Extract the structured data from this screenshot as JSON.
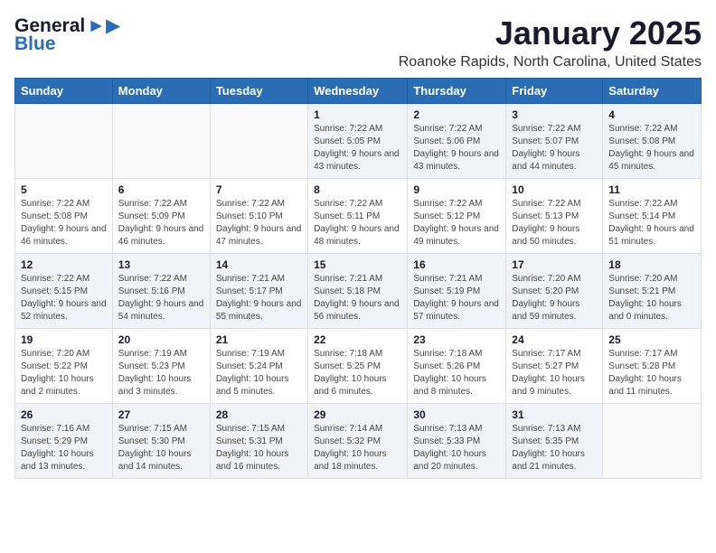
{
  "header": {
    "logo_line1": "General",
    "logo_line2": "Blue",
    "month": "January 2025",
    "location": "Roanoke Rapids, North Carolina, United States"
  },
  "weekdays": [
    "Sunday",
    "Monday",
    "Tuesday",
    "Wednesday",
    "Thursday",
    "Friday",
    "Saturday"
  ],
  "weeks": [
    [
      {
        "day": "",
        "info": ""
      },
      {
        "day": "",
        "info": ""
      },
      {
        "day": "",
        "info": ""
      },
      {
        "day": "1",
        "info": "Sunrise: 7:22 AM\nSunset: 5:05 PM\nDaylight: 9 hours and 43 minutes."
      },
      {
        "day": "2",
        "info": "Sunrise: 7:22 AM\nSunset: 5:06 PM\nDaylight: 9 hours and 43 minutes."
      },
      {
        "day": "3",
        "info": "Sunrise: 7:22 AM\nSunset: 5:07 PM\nDaylight: 9 hours and 44 minutes."
      },
      {
        "day": "4",
        "info": "Sunrise: 7:22 AM\nSunset: 5:08 PM\nDaylight: 9 hours and 45 minutes."
      }
    ],
    [
      {
        "day": "5",
        "info": "Sunrise: 7:22 AM\nSunset: 5:08 PM\nDaylight: 9 hours and 46 minutes."
      },
      {
        "day": "6",
        "info": "Sunrise: 7:22 AM\nSunset: 5:09 PM\nDaylight: 9 hours and 46 minutes."
      },
      {
        "day": "7",
        "info": "Sunrise: 7:22 AM\nSunset: 5:10 PM\nDaylight: 9 hours and 47 minutes."
      },
      {
        "day": "8",
        "info": "Sunrise: 7:22 AM\nSunset: 5:11 PM\nDaylight: 9 hours and 48 minutes."
      },
      {
        "day": "9",
        "info": "Sunrise: 7:22 AM\nSunset: 5:12 PM\nDaylight: 9 hours and 49 minutes."
      },
      {
        "day": "10",
        "info": "Sunrise: 7:22 AM\nSunset: 5:13 PM\nDaylight: 9 hours and 50 minutes."
      },
      {
        "day": "11",
        "info": "Sunrise: 7:22 AM\nSunset: 5:14 PM\nDaylight: 9 hours and 51 minutes."
      }
    ],
    [
      {
        "day": "12",
        "info": "Sunrise: 7:22 AM\nSunset: 5:15 PM\nDaylight: 9 hours and 52 minutes."
      },
      {
        "day": "13",
        "info": "Sunrise: 7:22 AM\nSunset: 5:16 PM\nDaylight: 9 hours and 54 minutes."
      },
      {
        "day": "14",
        "info": "Sunrise: 7:21 AM\nSunset: 5:17 PM\nDaylight: 9 hours and 55 minutes."
      },
      {
        "day": "15",
        "info": "Sunrise: 7:21 AM\nSunset: 5:18 PM\nDaylight: 9 hours and 56 minutes."
      },
      {
        "day": "16",
        "info": "Sunrise: 7:21 AM\nSunset: 5:19 PM\nDaylight: 9 hours and 57 minutes."
      },
      {
        "day": "17",
        "info": "Sunrise: 7:20 AM\nSunset: 5:20 PM\nDaylight: 9 hours and 59 minutes."
      },
      {
        "day": "18",
        "info": "Sunrise: 7:20 AM\nSunset: 5:21 PM\nDaylight: 10 hours and 0 minutes."
      }
    ],
    [
      {
        "day": "19",
        "info": "Sunrise: 7:20 AM\nSunset: 5:22 PM\nDaylight: 10 hours and 2 minutes."
      },
      {
        "day": "20",
        "info": "Sunrise: 7:19 AM\nSunset: 5:23 PM\nDaylight: 10 hours and 3 minutes."
      },
      {
        "day": "21",
        "info": "Sunrise: 7:19 AM\nSunset: 5:24 PM\nDaylight: 10 hours and 5 minutes."
      },
      {
        "day": "22",
        "info": "Sunrise: 7:18 AM\nSunset: 5:25 PM\nDaylight: 10 hours and 6 minutes."
      },
      {
        "day": "23",
        "info": "Sunrise: 7:18 AM\nSunset: 5:26 PM\nDaylight: 10 hours and 8 minutes."
      },
      {
        "day": "24",
        "info": "Sunrise: 7:17 AM\nSunset: 5:27 PM\nDaylight: 10 hours and 9 minutes."
      },
      {
        "day": "25",
        "info": "Sunrise: 7:17 AM\nSunset: 5:28 PM\nDaylight: 10 hours and 11 minutes."
      }
    ],
    [
      {
        "day": "26",
        "info": "Sunrise: 7:16 AM\nSunset: 5:29 PM\nDaylight: 10 hours and 13 minutes."
      },
      {
        "day": "27",
        "info": "Sunrise: 7:15 AM\nSunset: 5:30 PM\nDaylight: 10 hours and 14 minutes."
      },
      {
        "day": "28",
        "info": "Sunrise: 7:15 AM\nSunset: 5:31 PM\nDaylight: 10 hours and 16 minutes."
      },
      {
        "day": "29",
        "info": "Sunrise: 7:14 AM\nSunset: 5:32 PM\nDaylight: 10 hours and 18 minutes."
      },
      {
        "day": "30",
        "info": "Sunrise: 7:13 AM\nSunset: 5:33 PM\nDaylight: 10 hours and 20 minutes."
      },
      {
        "day": "31",
        "info": "Sunrise: 7:13 AM\nSunset: 5:35 PM\nDaylight: 10 hours and 21 minutes."
      },
      {
        "day": "",
        "info": ""
      }
    ]
  ]
}
